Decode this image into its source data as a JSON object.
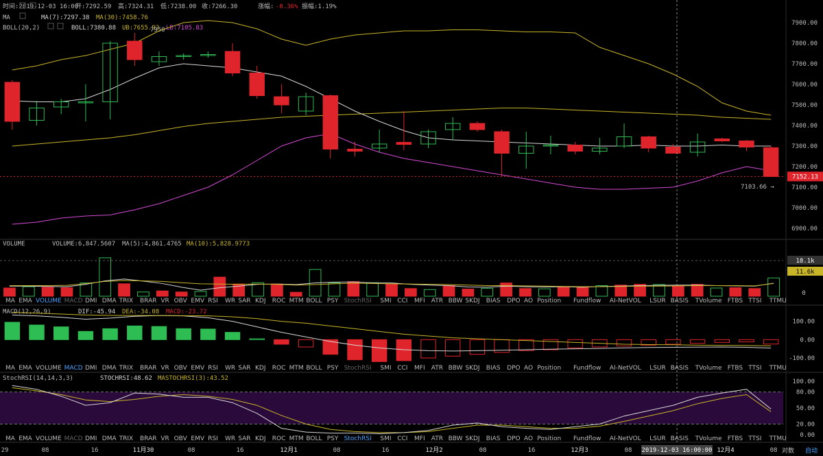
{
  "header": {
    "time_label": "时间:",
    "time": "2019-12-03 16:00",
    "open_label": "开:",
    "open": "7292.59",
    "high_label": "高:",
    "high": "7324.31",
    "low_label": "低:",
    "low": "7238.00",
    "close_label": "收:",
    "close": "7266.30",
    "change_label": "涨幅:",
    "change": "-0.36%",
    "amp_label": "振幅:",
    "amp": "1.19%"
  },
  "ma_row": {
    "name": "MA",
    "ma7": "MA(7):7297.38",
    "ma30": "MA(30):7458.76"
  },
  "boll_row": {
    "name": "BOLL(20,2)",
    "boll": "BOLL:7380.88",
    "ub": "UB:7655.92",
    "lb": "LB:7105.83",
    "hidden_val": "7950"
  },
  "price_axis": {
    "ticks": [
      "7900.00",
      "7800.00",
      "7700.00",
      "7600.00",
      "7500.00",
      "7400.00",
      "7300.00",
      "7200.00",
      "7100.00",
      "7000.00",
      "6900.00"
    ]
  },
  "current_price": "7152.13",
  "low_marker": "7103.66 →",
  "volume_panel": {
    "name": "VOLUME",
    "volume": "VOLUME:6,847.5607",
    "ma5": "MA(5):4,861.4765",
    "ma10": "MA(10):5,828.9773",
    "axis": [
      "18.1k",
      "11.6k",
      "0"
    ]
  },
  "macd_panel": {
    "name": "MACD(12,26,9)",
    "dif": "DIF:-45.94",
    "dea": "DEA:-34.08",
    "macd": "MACD:-23.72",
    "axis": [
      "100.00",
      "0.00",
      "-100.00"
    ]
  },
  "stoch_panel": {
    "name": "StochRSI(14,14,3,3)",
    "stochrsi": "STOCHRSI:48.62",
    "mastoch": "MASTOCHRSI(3):43.52",
    "axis": [
      "100.00",
      "80.00",
      "50.00",
      "20.00",
      "0.00"
    ]
  },
  "indicator_tabs": [
    "MA",
    "EMA",
    "VOLUME",
    "MACD",
    "DMI",
    "DMA",
    "TRIX",
    "BRAR",
    "VR",
    "OBV",
    "EMV",
    "RSI",
    "WR",
    "SAR",
    "KDJ",
    "ROC",
    "MTM",
    "BOLL",
    "PSY",
    "StochRSI",
    "SMI",
    "CCI",
    "MFI",
    "ATR",
    "BBW",
    "SKDJ",
    "BIAS",
    "DPO",
    "AO",
    "Position",
    "Fundflow",
    "AI-NetVOL",
    "LSUR",
    "BASIS",
    "TVolume",
    "FTBS",
    "TTSI",
    "TTMU"
  ],
  "time_axis": {
    "labels": [
      {
        "x": 7,
        "t": "29"
      },
      {
        "x": 66,
        "t": "08"
      },
      {
        "x": 138,
        "t": "16"
      },
      {
        "x": 209,
        "t": "11月30"
      },
      {
        "x": 279,
        "t": "08"
      },
      {
        "x": 350,
        "t": "16"
      },
      {
        "x": 421,
        "t": "12月1"
      },
      {
        "x": 491,
        "t": "08"
      },
      {
        "x": 562,
        "t": "16"
      },
      {
        "x": 633,
        "t": "12月2"
      },
      {
        "x": 704,
        "t": "08"
      },
      {
        "x": 775,
        "t": "16"
      },
      {
        "x": 845,
        "t": "12月3"
      },
      {
        "x": 916,
        "t": "08"
      },
      {
        "x": 1058,
        "t": "12月4"
      },
      {
        "x": 1128,
        "t": "08"
      }
    ],
    "crosshair_time": "2019-12-03 16:00:00",
    "log_button": "对数",
    "auto_button": "自动"
  },
  "colors": {
    "up": "#2ebd53",
    "down": "#e0242b",
    "ma7": "#d8d8d8",
    "ma30": "#c9b528",
    "boll_ub": "#c9b528",
    "boll_lb": "#d64bd6",
    "stoch_fill": "#2a0a3a"
  },
  "chart_data": [
    {
      "type": "candlestick",
      "title": "BOLL(20,2)",
      "interval": "8h",
      "x": [
        "11-29 00:00",
        "11-29 08:00",
        "11-29 16:00",
        "11-30 00:00",
        "11-30 08:00",
        "11-30 16:00",
        "12-01 00:00",
        "12-01 08:00",
        "12-01 16:00",
        "12-02 00:00",
        "12-02 08:00",
        "12-02 16:00",
        "12-03 00:00",
        "12-03 08:00",
        "12-03 16:00",
        "12-04 00:00"
      ],
      "candles": [
        {
          "o": 7610,
          "h": 7620,
          "l": 7380,
          "c": 7420
        },
        {
          "o": 7425,
          "h": 7520,
          "l": 7400,
          "c": 7485
        },
        {
          "o": 7490,
          "h": 7530,
          "l": 7455,
          "c": 7515
        },
        {
          "o": 7510,
          "h": 7600,
          "l": 7420,
          "c": 7515
        },
        {
          "o": 7515,
          "h": 7810,
          "l": 7430,
          "c": 7800
        },
        {
          "o": 7810,
          "h": 7850,
          "l": 7690,
          "c": 7720
        },
        {
          "o": 7710,
          "h": 7760,
          "l": 7690,
          "c": 7735
        },
        {
          "o": 7735,
          "h": 7750,
          "l": 7720,
          "c": 7740
        },
        {
          "o": 7740,
          "h": 7760,
          "l": 7730,
          "c": 7745
        },
        {
          "o": 7760,
          "h": 7800,
          "l": 7640,
          "c": 7655
        },
        {
          "o": 7655,
          "h": 7690,
          "l": 7530,
          "c": 7545
        },
        {
          "o": 7540,
          "h": 7600,
          "l": 7460,
          "c": 7500
        },
        {
          "o": 7470,
          "h": 7560,
          "l": 7450,
          "c": 7540
        },
        {
          "o": 7545,
          "h": 7550,
          "l": 7240,
          "c": 7285
        },
        {
          "o": 7285,
          "h": 7320,
          "l": 7250,
          "c": 7275
        },
        {
          "o": 7290,
          "h": 7380,
          "l": 7270,
          "c": 7310
        },
        {
          "o": 7318,
          "h": 7470,
          "l": 7280,
          "c": 7308
        },
        {
          "o": 7310,
          "h": 7380,
          "l": 7290,
          "c": 7370
        },
        {
          "o": 7380,
          "h": 7440,
          "l": 7330,
          "c": 7410
        },
        {
          "o": 7410,
          "h": 7420,
          "l": 7370,
          "c": 7380
        },
        {
          "o": 7370,
          "h": 7380,
          "l": 7150,
          "c": 7265
        },
        {
          "o": 7265,
          "h": 7370,
          "l": 7190,
          "c": 7300
        },
        {
          "o": 7300,
          "h": 7350,
          "l": 7260,
          "c": 7305
        },
        {
          "o": 7305,
          "h": 7320,
          "l": 7260,
          "c": 7275
        },
        {
          "o": 7275,
          "h": 7340,
          "l": 7260,
          "c": 7290
        },
        {
          "o": 7300,
          "h": 7410,
          "l": 7290,
          "c": 7345
        },
        {
          "o": 7345,
          "h": 7350,
          "l": 7270,
          "c": 7290
        },
        {
          "o": 7295,
          "h": 7310,
          "l": 7265,
          "c": 7265
        },
        {
          "o": 7270,
          "h": 7360,
          "l": 7250,
          "c": 7320
        },
        {
          "o": 7335,
          "h": 7340,
          "l": 7320,
          "c": 7325
        },
        {
          "o": 7325,
          "h": 7330,
          "l": 7275,
          "c": 7295
        },
        {
          "o": 7292,
          "h": 7300,
          "l": 7150,
          "c": 7152
        }
      ],
      "ma7": [
        7520,
        7515,
        7515,
        7530,
        7575,
        7630,
        7680,
        7700,
        7690,
        7680,
        7660,
        7640,
        7590,
        7530,
        7470,
        7420,
        7375,
        7340,
        7330,
        7325,
        7320,
        7315,
        7310,
        7305,
        7300,
        7300,
        7305,
        7300,
        7300,
        7305,
        7300,
        7300
      ],
      "ma30": [
        7300,
        7310,
        7320,
        7330,
        7340,
        7355,
        7375,
        7395,
        7410,
        7420,
        7430,
        7440,
        7445,
        7450,
        7455,
        7460,
        7465,
        7470,
        7475,
        7480,
        7485,
        7485,
        7480,
        7475,
        7470,
        7465,
        7460,
        7455,
        7450,
        7440,
        7435,
        7430
      ],
      "boll_ub": [
        7670,
        7690,
        7720,
        7740,
        7770,
        7800,
        7860,
        7900,
        7910,
        7900,
        7870,
        7820,
        7790,
        7820,
        7840,
        7850,
        7860,
        7860,
        7865,
        7865,
        7860,
        7855,
        7855,
        7850,
        7780,
        7740,
        7700,
        7650,
        7590,
        7510,
        7470,
        7450
      ],
      "boll_lb": [
        6920,
        6930,
        6950,
        6960,
        6965,
        6990,
        7020,
        7060,
        7100,
        7160,
        7230,
        7300,
        7340,
        7360,
        7310,
        7270,
        7240,
        7220,
        7200,
        7180,
        7160,
        7140,
        7120,
        7100,
        7090,
        7090,
        7095,
        7100,
        7130,
        7170,
        7200,
        7180
      ],
      "ylim": [
        6850,
        7950
      ]
    },
    {
      "type": "bar",
      "title": "VOLUME",
      "values": [
        3.1,
        3.6,
        3.4,
        3.2,
        5.0,
        14.5,
        4.7,
        1.6,
        2.0,
        1.6,
        1.8,
        7.2,
        4.6,
        5.1,
        4.6,
        1.5,
        10.1,
        5.0,
        5.5,
        5.1,
        4.5,
        2.9,
        2.5,
        4.0,
        2.7,
        3.0,
        5.0,
        2.9,
        2.8,
        3.4,
        3.6,
        4.0,
        4.2,
        4.5,
        4.4,
        3.9,
        4.5,
        3.1,
        3.2,
        2.9,
        6.9
      ],
      "ma5": [
        3.8,
        3.8,
        3.7,
        3.6,
        4.5,
        5.8,
        6.5,
        5.7,
        4.8,
        3.4,
        2.3,
        3.2,
        3.8,
        4.5,
        4.6,
        4.4,
        5.0,
        5.3,
        5.4,
        5.0,
        5.0,
        4.5,
        4.2,
        4.0,
        3.5,
        3.4,
        3.8,
        3.6,
        3.5,
        3.6,
        3.4,
        3.7,
        3.8,
        4.0,
        4.1,
        4.2,
        4.2,
        4.0,
        3.9,
        3.8,
        4.9
      ],
      "ma10": [
        4.0,
        4.0,
        4.0,
        4.1,
        4.8,
        5.6,
        5.9,
        5.8,
        5.6,
        5.1,
        4.7,
        4.6,
        4.5,
        4.6,
        4.5,
        4.2,
        4.4,
        4.7,
        4.9,
        4.8,
        4.7,
        4.6,
        4.5,
        4.4,
        4.2,
        4.0,
        4.0,
        3.9,
        3.8,
        3.7,
        3.6,
        3.6,
        3.7,
        3.8,
        3.8,
        3.9,
        4.0,
        4.0,
        4.0,
        3.9,
        4.8
      ],
      "ylim": [
        0,
        18.1
      ]
    },
    {
      "type": "bar",
      "title": "MACD(12,26,9)",
      "hist": [
        95,
        80,
        70,
        45,
        60,
        75,
        72,
        60,
        58,
        40,
        5,
        -25,
        -40,
        -80,
        -110,
        -120,
        -115,
        -100,
        -90,
        -80,
        -70,
        -60,
        -55,
        -45,
        -40,
        -35,
        -30,
        -25,
        -20,
        -15,
        -12,
        -24
      ],
      "dif": [
        135,
        130,
        122,
        112,
        118,
        128,
        132,
        130,
        120,
        100,
        70,
        40,
        15,
        -10,
        -30,
        -45,
        -55,
        -60,
        -62,
        -60,
        -58,
        -55,
        -52,
        -50,
        -48,
        -45,
        -43,
        -42,
        -41,
        -40,
        -42,
        -46
      ],
      "dea": [
        150,
        145,
        140,
        135,
        133,
        132,
        132,
        131,
        130,
        125,
        115,
        100,
        90,
        75,
        60,
        45,
        30,
        20,
        10,
        5,
        0,
        -5,
        -10,
        -15,
        -20,
        -25,
        -27,
        -28,
        -30,
        -31,
        -32,
        -34
      ],
      "ylim": [
        -130,
        140
      ]
    },
    {
      "type": "line",
      "title": "StochRSI(14,14,3,3)",
      "stochrsi": [
        92,
        85,
        72,
        55,
        60,
        78,
        76,
        70,
        70,
        60,
        40,
        12,
        5,
        3,
        3,
        2,
        4,
        8,
        18,
        22,
        15,
        12,
        10,
        15,
        20,
        35,
        45,
        55,
        70,
        78,
        85,
        48
      ],
      "mastochrsi": [
        88,
        82,
        75,
        65,
        62,
        66,
        72,
        75,
        72,
        66,
        55,
        36,
        20,
        10,
        6,
        4,
        4,
        6,
        12,
        18,
        18,
        15,
        12,
        12,
        16,
        25,
        35,
        45,
        58,
        68,
        75,
        43
      ],
      "ylim": [
        0,
        100
      ]
    }
  ]
}
